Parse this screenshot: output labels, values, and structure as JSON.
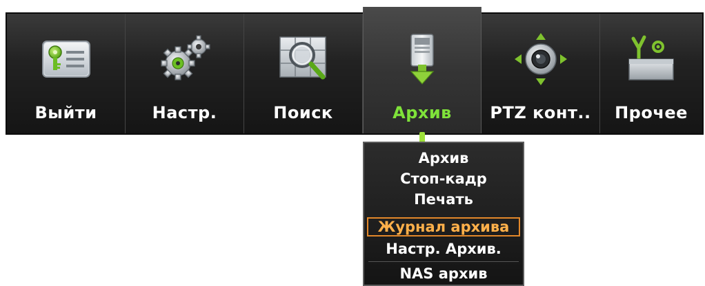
{
  "menu": {
    "items": [
      {
        "label": "Выйти",
        "icon": "logout-card-icon"
      },
      {
        "label": "Настр.",
        "icon": "settings-gears-icon"
      },
      {
        "label": "Поиск",
        "icon": "search-magnifier-icon"
      },
      {
        "label": "Архив",
        "icon": "archive-download-icon"
      },
      {
        "label": "PTZ конт..",
        "icon": "ptz-camera-icon"
      },
      {
        "label": "Прочее",
        "icon": "misc-tools-icon"
      }
    ],
    "active_index": 3,
    "active_color": "#7fe23a"
  },
  "dropdown": {
    "items": [
      {
        "label": "Архив"
      },
      {
        "label": "Стоп-кадр"
      },
      {
        "label": "Печать"
      },
      {
        "label": "Журнал архива"
      },
      {
        "label": "Настр. Архив."
      },
      {
        "label": "NAS архив"
      }
    ],
    "selected_index": 3,
    "selected_color": "#e3882a"
  }
}
